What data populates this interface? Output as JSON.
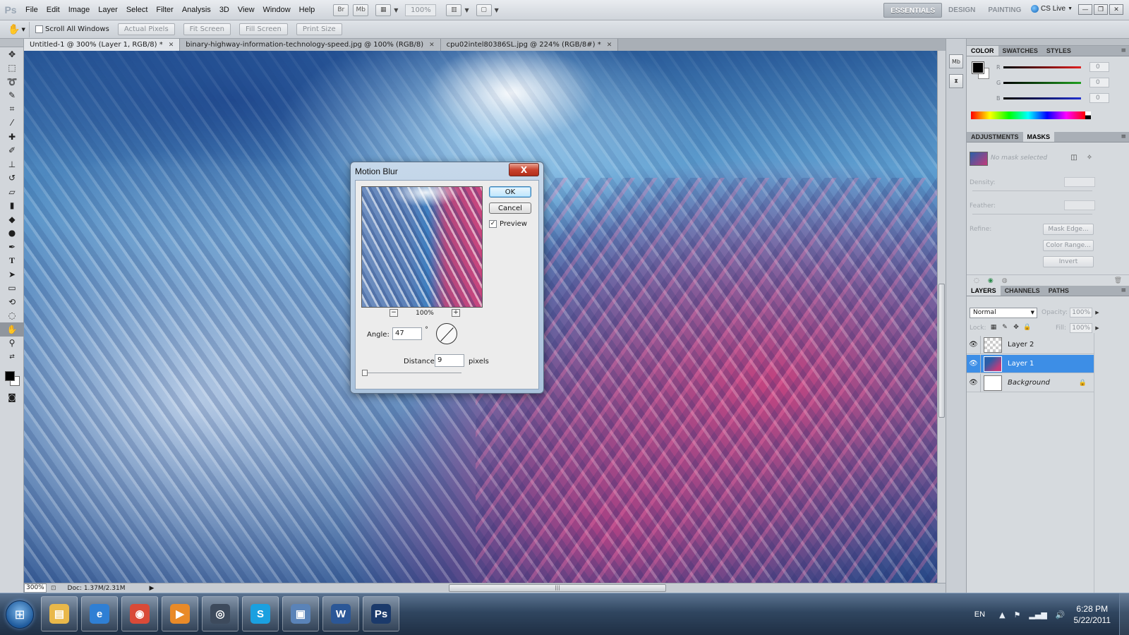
{
  "app": {
    "logo": "Ps"
  },
  "menubar": {
    "items": [
      "File",
      "Edit",
      "Image",
      "Layer",
      "Select",
      "Filter",
      "Analysis",
      "3D",
      "View",
      "Window",
      "Help"
    ],
    "zoom_readout": "100%",
    "workspaces": [
      "ESSENTIALS",
      "DESIGN",
      "PAINTING"
    ],
    "workspace_more": "»",
    "cs_live": "CS Live"
  },
  "options_bar": {
    "scroll_all_windows": "Scroll All Windows",
    "buttons": [
      "Actual Pixels",
      "Fit Screen",
      "Fill Screen",
      "Print Size"
    ]
  },
  "doc_tabs": [
    {
      "label": "Untitled-1 @ 300% (Layer 1, RGB/8) *",
      "active": true
    },
    {
      "label": "binary-highway-information-technology-speed.jpg @ 100% (RGB/8)",
      "active": false
    },
    {
      "label": "cpu02intel80386SL.jpg @ 224% (RGB/8#) *",
      "active": false
    }
  ],
  "status_bar": {
    "zoom": "300%",
    "doc_size": "Doc: 1.37M/2.31M"
  },
  "color_panel": {
    "tabs": [
      "COLOR",
      "SWATCHES",
      "STYLES"
    ],
    "channels": [
      {
        "letter": "R",
        "value": "0",
        "color": "#e02020"
      },
      {
        "letter": "G",
        "value": "0",
        "color": "#20a020"
      },
      {
        "letter": "B",
        "value": "0",
        "color": "#2030d0"
      }
    ]
  },
  "masks_panel": {
    "tabs": [
      "ADJUSTMENTS",
      "MASKS"
    ],
    "no_mask": "No mask selected",
    "density_label": "Density:",
    "feather_label": "Feather:",
    "refine_label": "Refine:",
    "buttons": [
      "Mask Edge...",
      "Color Range...",
      "Invert"
    ]
  },
  "layers_panel": {
    "tabs": [
      "LAYERS",
      "CHANNELS",
      "PATHS"
    ],
    "blend_mode": "Normal",
    "opacity_label": "Opacity:",
    "opacity_value": "100%",
    "lock_label": "Lock:",
    "fill_label": "Fill:",
    "fill_value": "100%",
    "layers": [
      {
        "name": "Layer 2",
        "selected": false,
        "locked": false,
        "thumb": "transparent"
      },
      {
        "name": "Layer 1",
        "selected": true,
        "locked": false,
        "thumb": "image"
      },
      {
        "name": "Background",
        "selected": false,
        "locked": true,
        "thumb": "white"
      }
    ]
  },
  "dialog": {
    "title": "Motion Blur",
    "close_symbol": "X",
    "ok_label": "OK",
    "cancel_label": "Cancel",
    "preview_label": "Preview",
    "preview_checked": true,
    "preview_zoom": "100%",
    "zoom_out": "−",
    "zoom_in": "+",
    "angle_label": "Angle:",
    "angle_value": "47",
    "degree_symbol": "°",
    "distance_label": "Distance:",
    "distance_value": "9",
    "distance_unit": "pixels",
    "distance_fraction": 0.02
  },
  "taskbar": {
    "apps": [
      {
        "icon": "folder-icon",
        "glyph": "▤",
        "color": "#e9b84a"
      },
      {
        "icon": "internet-explorer-icon",
        "glyph": "e",
        "color": "#2f7fd4"
      },
      {
        "icon": "chrome-icon",
        "glyph": "◉",
        "color": "#d94a38"
      },
      {
        "icon": "media-player-icon",
        "glyph": "▶",
        "color": "#e98a28"
      },
      {
        "icon": "camera-icon",
        "glyph": "◎",
        "color": "#3d4a5c"
      },
      {
        "icon": "skype-icon",
        "glyph": "S",
        "color": "#1aa0e0"
      },
      {
        "icon": "network-icon",
        "glyph": "▣",
        "color": "#5a83b8"
      },
      {
        "icon": "word-icon",
        "glyph": "W",
        "color": "#2b5797"
      },
      {
        "icon": "photoshop-icon",
        "glyph": "Ps",
        "color": "#1b3a6b"
      }
    ],
    "language": "EN",
    "time": "6:28 PM",
    "date": "5/22/2011"
  }
}
